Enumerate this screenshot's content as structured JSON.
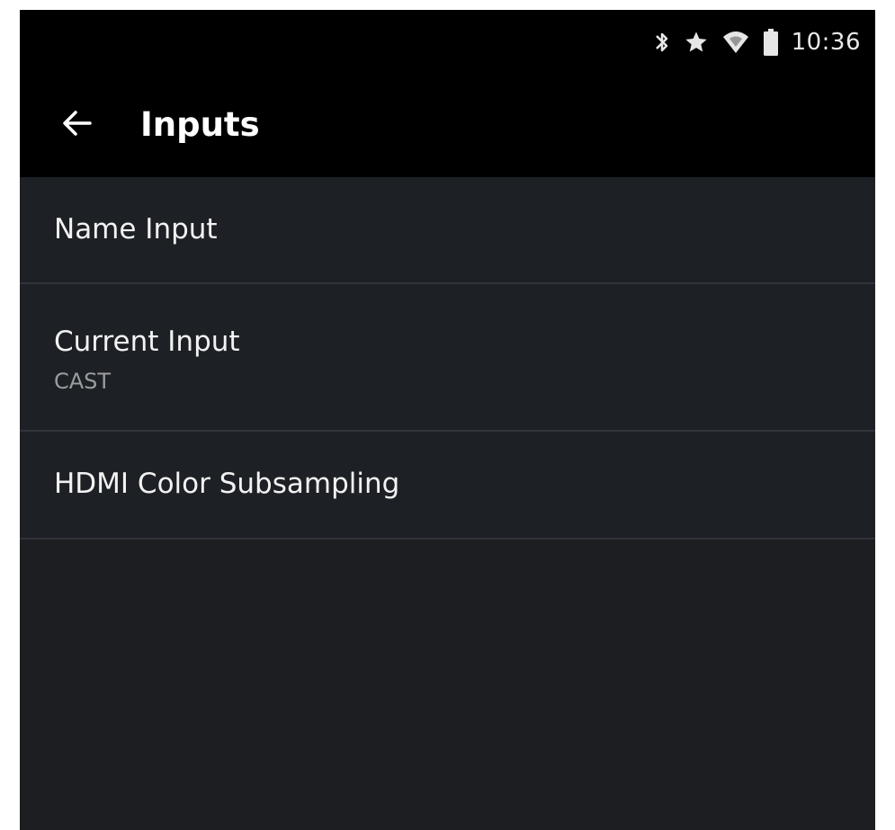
{
  "status_bar": {
    "time": "10:36",
    "icons": [
      "bluetooth-icon",
      "star-icon",
      "wifi-icon",
      "battery-icon"
    ]
  },
  "app_bar": {
    "back_icon": "arrow-left-icon",
    "title": "Inputs"
  },
  "menu": {
    "items": [
      {
        "label": "Name Input"
      },
      {
        "label": "Current Input",
        "value": "CAST"
      },
      {
        "label": "HDMI Color Subsampling"
      }
    ]
  },
  "colors": {
    "status_bar_bg": "#000000",
    "app_bar_bg": "#000000",
    "list_bg": "#1c1e21",
    "divider": "#30343a",
    "primary_text": "#f2f2f2",
    "secondary_text": "#9a9ca0"
  }
}
